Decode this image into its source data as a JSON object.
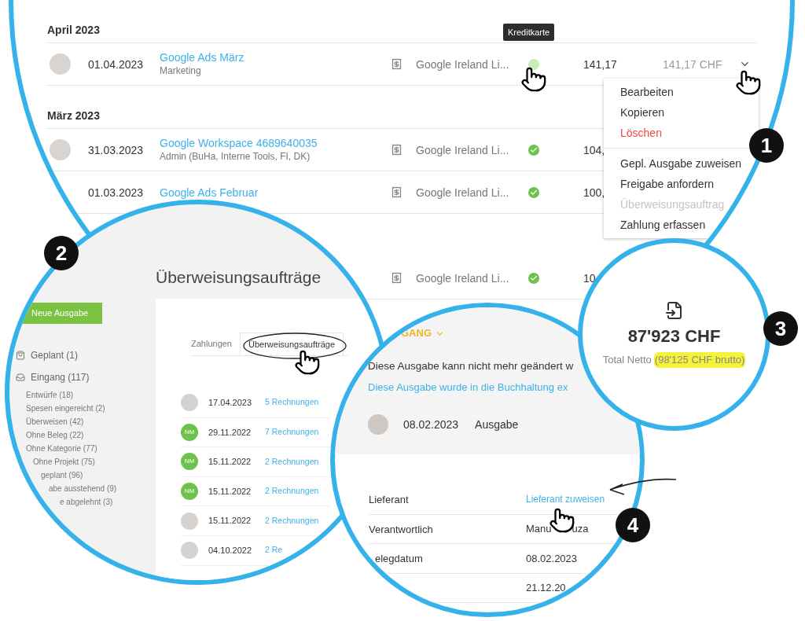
{
  "expense_list": {
    "sections": [
      {
        "heading": "April 2023",
        "rows": [
          {
            "avatar": true,
            "date": "01.04.2023",
            "title": "Google Ads März",
            "subtitle": "Marketing",
            "vendor": "Google Ireland Li...",
            "paid": false,
            "tooltip": "Kreditkarte",
            "amount": "141,17",
            "gross": "141,17 CHF",
            "menu_open": true
          }
        ]
      },
      {
        "heading": "März 2023",
        "rows": [
          {
            "avatar": true,
            "date": "31.03.2023",
            "title": "Google Workspace 4689640035",
            "subtitle": "Admin (BuHa, Interne Tools, FI, DK)",
            "vendor": "Google Ireland Li...",
            "paid": true,
            "amount": "104,",
            "menu_open": false
          },
          {
            "avatar": false,
            "date": "01.03.2023",
            "title": "Google Ads Februar",
            "vendor": "Google Ireland Li...",
            "paid": true,
            "amount": "100,",
            "menu_open": false
          },
          {
            "vendor": "Google Ireland Li...",
            "paid": true,
            "amount": "10"
          }
        ]
      }
    ]
  },
  "row_menu": {
    "groups": [
      [
        {
          "label": "Bearbeiten",
          "kind": "normal"
        },
        {
          "label": "Kopieren",
          "kind": "normal"
        },
        {
          "label": "Löschen",
          "kind": "danger"
        }
      ],
      [
        {
          "label": "Gepl. Ausgabe zuweisen",
          "kind": "normal"
        },
        {
          "label": "Freigabe anfordern",
          "kind": "normal"
        },
        {
          "label": "Überweisungsauftrag",
          "kind": "disabled"
        },
        {
          "label": "Zahlung erfassen",
          "kind": "normal"
        }
      ]
    ]
  },
  "transfer_orders": {
    "new_button": "Neue Ausgabe",
    "sidebar": [
      {
        "label": "Geplant (1)",
        "kind": "bag"
      },
      {
        "label": "Eingang (117)",
        "kind": "inbox",
        "children": [
          {
            "label": "Entwürfe (18)"
          },
          {
            "label": "Spesen eingereicht (2)"
          },
          {
            "label": "Überweisen (42)"
          },
          {
            "label": "Ohne Beleg (22)"
          },
          {
            "label": "Ohne Kategorie (77)"
          },
          {
            "label": "Ohne Projekt (75)"
          },
          {
            "label": "geplant (96)"
          },
          {
            "label": "abe ausstehend (9)"
          },
          {
            "label": "e abgelehnt (3)"
          }
        ]
      }
    ],
    "title": "Überweisungsaufträge",
    "tabs": [
      {
        "label": "Zahlungen",
        "selected": false
      },
      {
        "label": "Überweisungsaufträge",
        "selected": true
      }
    ],
    "rows": [
      {
        "kind": "photo",
        "date": "17.04.2023",
        "link": "5 Rechnungen"
      },
      {
        "kind": "initials",
        "initials": "NM",
        "date": "29.11.2022",
        "link": "7 Rechnungen"
      },
      {
        "kind": "initials",
        "initials": "NM",
        "date": "15.11.2022",
        "link": "2 Rechnungen"
      },
      {
        "kind": "initials",
        "initials": "NM",
        "date": "15.11.2022",
        "link": "2 Rechnungen"
      },
      {
        "kind": "photo",
        "date": "15.11.2022",
        "link": "2 Rechnungen"
      },
      {
        "kind": "photo",
        "date": "04.10.2022",
        "link": "2 Re"
      }
    ]
  },
  "totals": {
    "amount": "87'923 CHF",
    "label": "Total Netto",
    "gross": "(98'125 CHF brutto)"
  },
  "expense_detail": {
    "status": "GANG",
    "notice": "Diese Ausgabe kann nicht mehr geändert w",
    "export_link": "Diese Ausgabe wurde in die Buchhaltung ex",
    "date": "08.02.2023",
    "type": "Ausgabe",
    "fields": [
      {
        "label": "Lieferant",
        "value": "Lieferant zuweisen",
        "kind": "link"
      },
      {
        "label": "Verantwortlich",
        "value": "Manu",
        "value_end": "uza",
        "kind": "text"
      },
      {
        "label": "elegdatum",
        "value": "08.02.2023",
        "kind": "text"
      },
      {
        "value": "21.12.20",
        "kind": "text"
      }
    ]
  },
  "badges": [
    "1",
    "2",
    "3",
    "4"
  ]
}
